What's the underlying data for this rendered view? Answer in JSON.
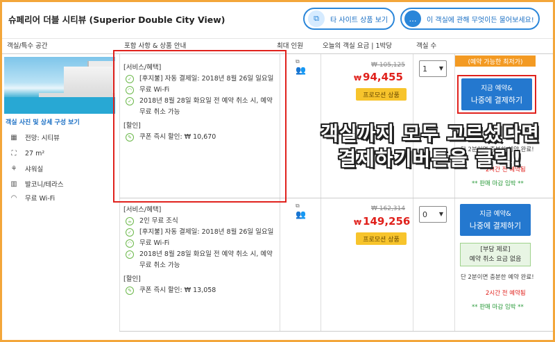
{
  "header": {
    "room_name": "슈페리어 더블 시티뷰 (Superior Double City View)",
    "other_sites_btn": "타 사이트 상품 보기",
    "ask_btn": "이 객실에 관해 무엇이든 물어보세요!"
  },
  "columns": {
    "room": "객실/특수 공간",
    "includes": "포함 사항 & 상품 안내",
    "max_people": "최대 인원",
    "price": "오늘의 객실 요금 | 1박당",
    "rooms": "객실 수"
  },
  "room_info": {
    "photo_link": "객실 사진 및 상세 구성 보기",
    "features": [
      {
        "icon": "view-icon",
        "label": "전망: 시티뷰"
      },
      {
        "icon": "size-icon",
        "label": "27 m²"
      },
      {
        "icon": "shower-icon",
        "label": "샤워실"
      },
      {
        "icon": "balcony-icon",
        "label": "발코니/테라스"
      },
      {
        "icon": "wifi-icon",
        "label": "무료 Wi-Fi"
      }
    ]
  },
  "offers": [
    {
      "services_heading": "[서비스/혜택]",
      "services": [
        "[후지불] 자동 결제일: 2018년 8월 26일 일요일",
        "무료 Wi-Fi",
        "2018년 8월 28일 화요일 전 예약 취소 시, 예약 무료 취소 가능"
      ],
      "discount_heading": "[할인]",
      "discount": "쿠폰 즉시 할인: ₩ 10,670",
      "old_price": "₩ 105,125",
      "currency": "₩",
      "new_price": "94,455",
      "promo": "프로모션 상품",
      "qty": "1",
      "best_label": "(예약 가능한 최저가)",
      "book_line1": "지금 예약&",
      "book_line2": "나중에 결제하기",
      "note1": "단 2분이면 충분한 예약 완료!",
      "note2": "2시간 전 예약됨",
      "closing": "** 판매 마감 임박 **"
    },
    {
      "services_heading": "[서비스/혜택]",
      "services": [
        "2인 무료 조식",
        "[후지불] 자동 결제일: 2018년 8월 26일 일요일",
        "무료 Wi-Fi",
        "2018년 8월 28일 화요일 전 예약 취소 시, 예약 무료 취소 가능"
      ],
      "discount_heading": "[할인]",
      "discount": "쿠폰 즉시 할인: ₩ 13,058",
      "old_price": "₩ 162,314",
      "currency": "₩",
      "new_price": "149,256",
      "promo": "프로모션 상품",
      "qty": "0",
      "book_line1": "지금 예약&",
      "book_line2": "나중에 결제하기",
      "nocancel_line1": "[부담 제로]",
      "nocancel_line2": "예약 취소 요금 없음",
      "note1": "단 2분이면 충분한 예약 완료!",
      "note2": "2시간 전 예약됨",
      "closing": "** 판매 마감 임박 **"
    }
  ],
  "overlay": {
    "line1": "객실까지 모두 고르셨다면",
    "line2": "결제하기버튼을 클릭!"
  },
  "colors": {
    "frame": "#f3a63a",
    "accent_blue": "#2478cf",
    "price_red": "#e0211c",
    "promo_yellow": "#f7c42c",
    "highlight_red": "#e0211c"
  }
}
